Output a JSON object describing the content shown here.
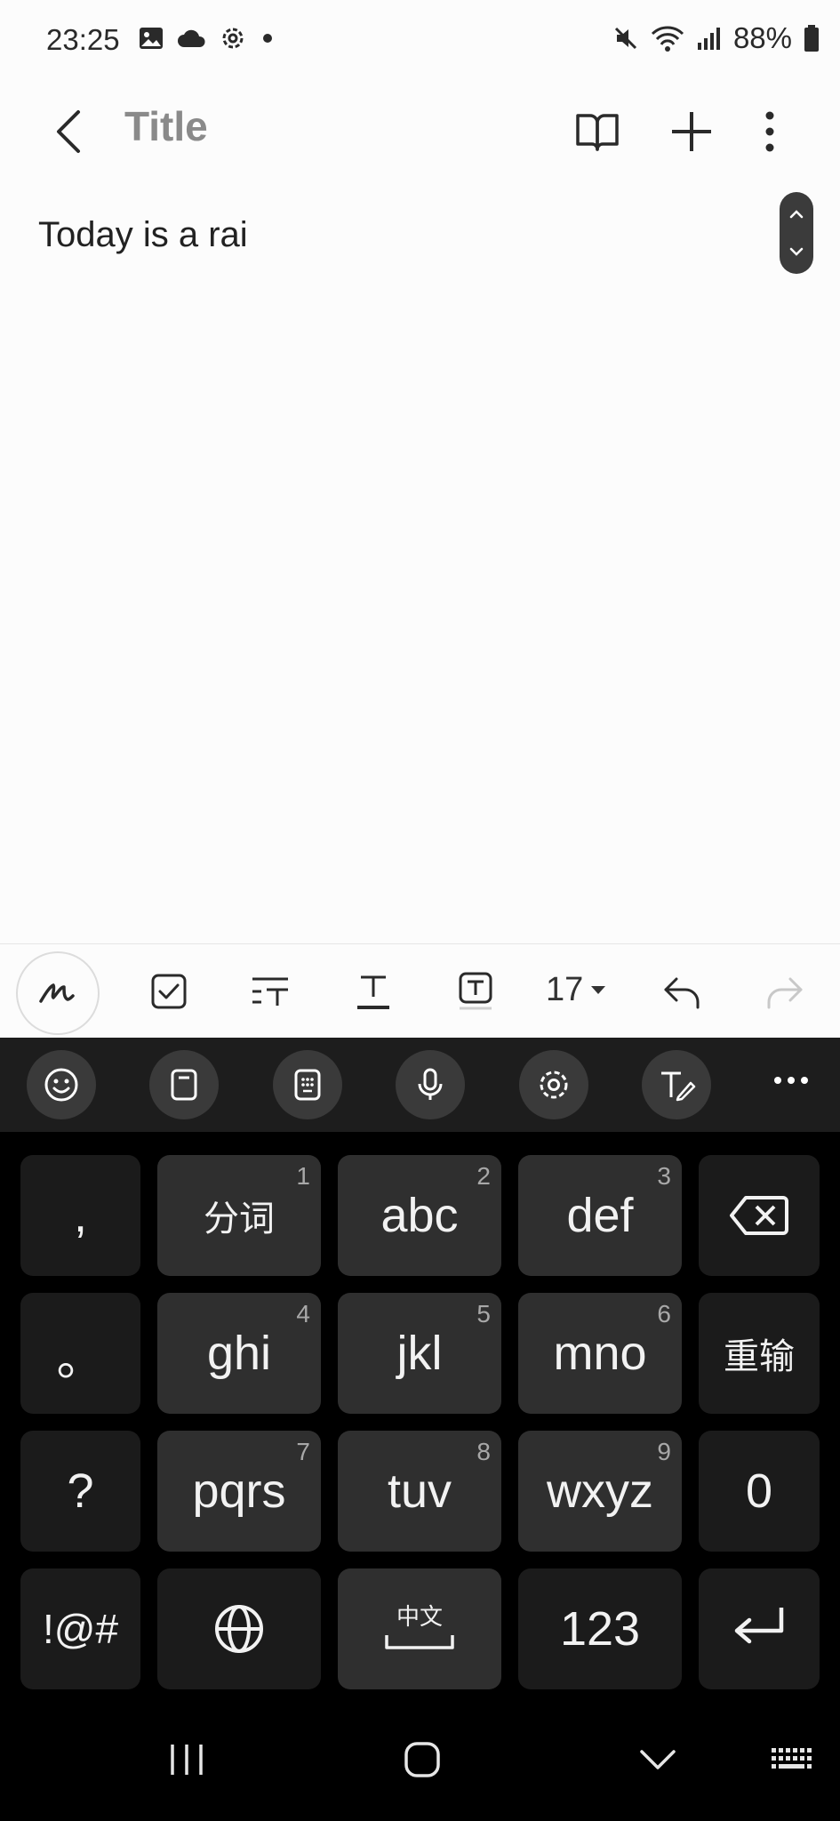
{
  "status_bar": {
    "time": "23:25",
    "left_icons": [
      "gallery-icon",
      "cloud-icon",
      "settings-icon",
      "dot-icon"
    ],
    "right_icons": [
      "mute-icon",
      "wifi-icon",
      "signal-icon"
    ],
    "battery": "88%"
  },
  "app_bar": {
    "title": "Title",
    "icons": [
      "back-icon",
      "book-icon",
      "plus-icon",
      "more-vert-icon"
    ]
  },
  "editor": {
    "text": "Today is a rai"
  },
  "toolbar": {
    "font_size": "17",
    "icons": [
      "handwriting-icon",
      "checkbox-icon",
      "text-style-icon",
      "underline-text-icon",
      "text-box-icon",
      "undo-icon",
      "redo-icon"
    ]
  },
  "keyboard": {
    "bar_icons": [
      "emoji-icon",
      "clipboard-icon",
      "keypad-icon",
      "mic-icon",
      "settings-icon",
      "handwriting-text-icon",
      "more-horiz-icon"
    ],
    "rows": [
      [
        {
          "label": ",",
          "num": ""
        },
        {
          "label": "分词",
          "num": "1"
        },
        {
          "label": "abc",
          "num": "2"
        },
        {
          "label": "def",
          "num": "3"
        },
        {
          "label": "",
          "num": "",
          "icon": "backspace-icon"
        }
      ],
      [
        {
          "label": "。",
          "num": ""
        },
        {
          "label": "ghi",
          "num": "4"
        },
        {
          "label": "jkl",
          "num": "5"
        },
        {
          "label": "mno",
          "num": "6"
        },
        {
          "label": "重输",
          "num": ""
        }
      ],
      [
        {
          "label": "?",
          "num": ""
        },
        {
          "label": "pqrs",
          "num": "7"
        },
        {
          "label": "tuv",
          "num": "8"
        },
        {
          "label": "wxyz",
          "num": "9"
        },
        {
          "label": "0",
          "num": ""
        }
      ],
      [
        {
          "label": "!@#",
          "num": ""
        },
        {
          "label": "",
          "num": "",
          "icon": "globe-icon"
        },
        {
          "label": "中文",
          "num": "",
          "icon": "space-icon"
        },
        {
          "label": "123",
          "num": ""
        },
        {
          "label": "",
          "num": "",
          "icon": "enter-icon"
        }
      ]
    ]
  },
  "nav_bar": {
    "icons": [
      "recents-icon",
      "home-icon",
      "hide-keyboard-icon",
      "keyboard-switch-icon"
    ]
  }
}
